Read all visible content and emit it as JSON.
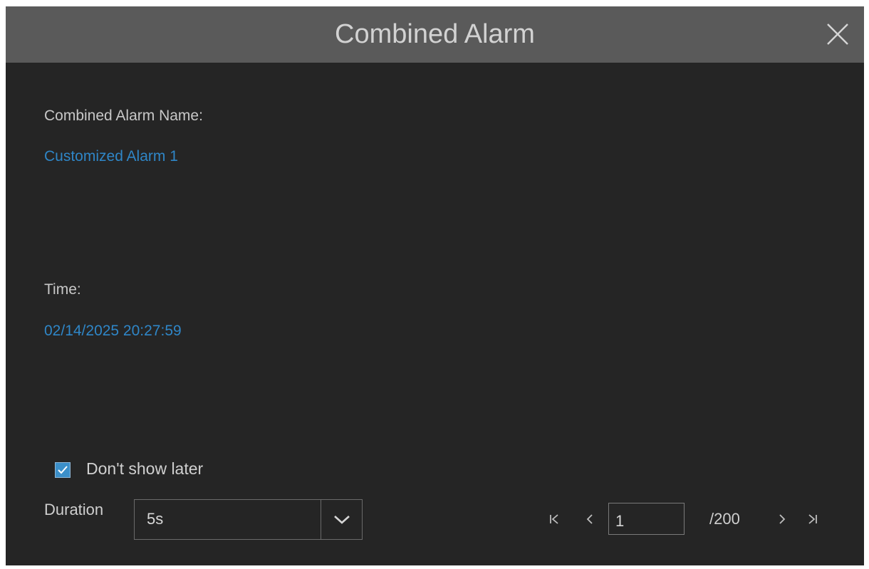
{
  "dialog": {
    "title": "Combined Alarm",
    "close_icon": "close-icon"
  },
  "fields": {
    "alarm_name_label": "Combined Alarm Name:",
    "alarm_name_value": "Customized Alarm 1",
    "time_label": "Time:",
    "time_value": "02/14/2025 20:27:59"
  },
  "options": {
    "dont_show_later_label": "Don't show later",
    "dont_show_later_checked": true,
    "duration_label": "Duration",
    "duration_value": "5s"
  },
  "pager": {
    "current_page": "1",
    "total_pages": "/200",
    "first_icon": "first-page-icon",
    "prev_icon": "previous-page-icon",
    "next_icon": "next-page-icon",
    "last_icon": "last-page-icon"
  },
  "colors": {
    "background": "#252525",
    "titlebar": "#5a5a5a",
    "accent": "#2f86c7"
  }
}
